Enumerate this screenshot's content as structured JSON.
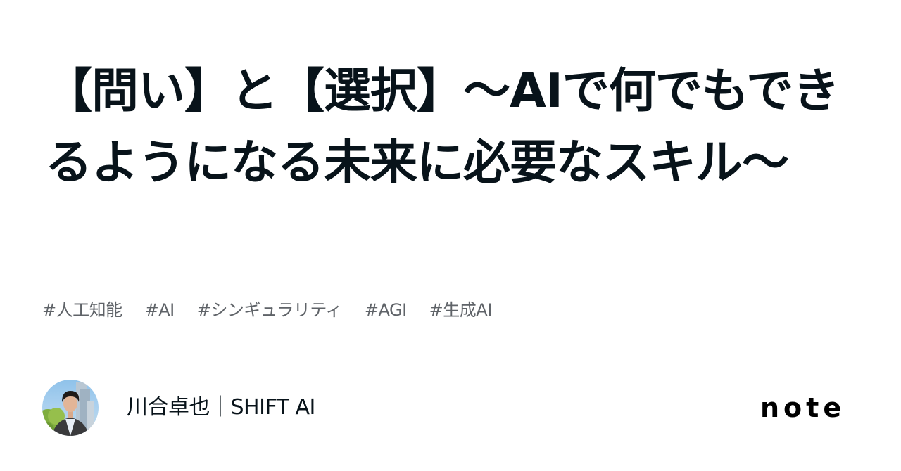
{
  "article": {
    "title": "【問い】と【選択】〜AIで何でもできるようになる未来に必要なスキル〜",
    "tags": [
      "#人工知能",
      "#AI",
      "#シンギュラリティ",
      "#AGI",
      "#生成AI"
    ]
  },
  "author": {
    "name": "川合卓也｜SHIFT AI",
    "avatar_icon": "user-photo-avatar"
  },
  "brand": {
    "logo_text": "note"
  }
}
